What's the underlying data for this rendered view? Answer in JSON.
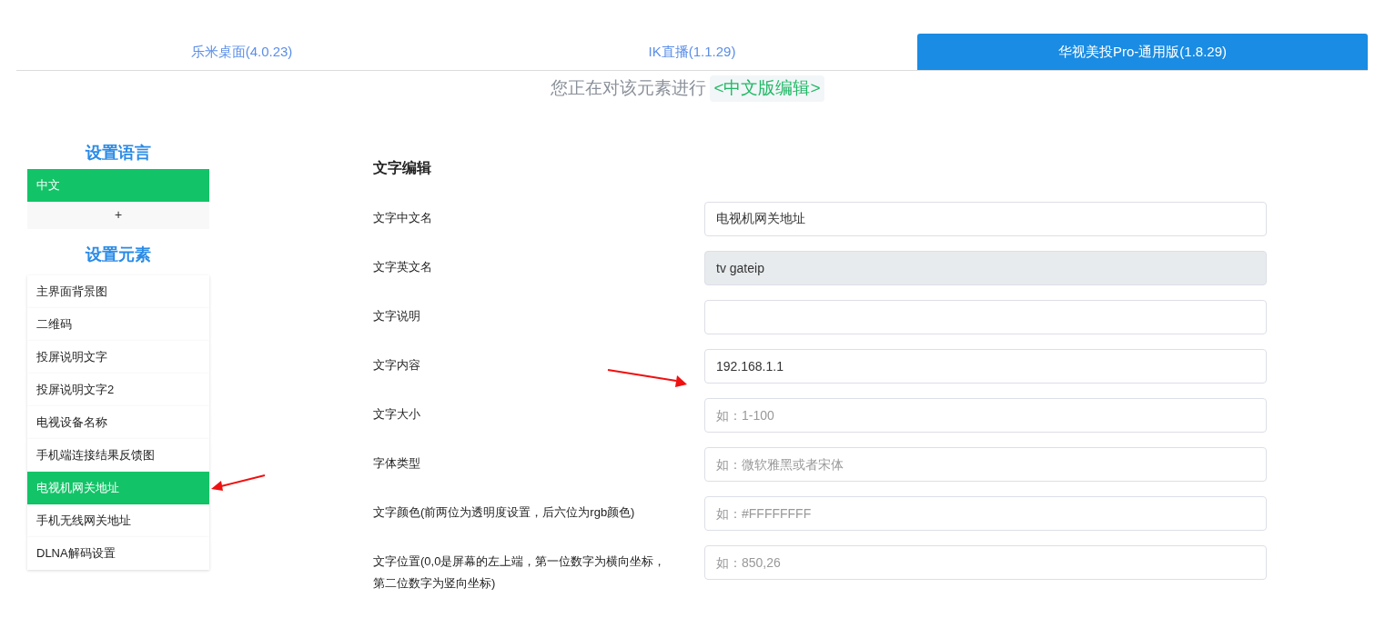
{
  "tabs": [
    {
      "label": "乐米桌面(4.0.23)",
      "selected": false
    },
    {
      "label": "IK直播(1.1.29)",
      "selected": false
    },
    {
      "label": "华视美投Pro-通用版(1.8.29)",
      "selected": true
    }
  ],
  "subtitle": {
    "text": "您正在对该元素进行",
    "tag": "<中文版编辑>"
  },
  "sidebar": {
    "language_title": "设置语言",
    "languages": [
      {
        "label": "中文",
        "selected": true
      }
    ],
    "add_button": "+",
    "elements_title": "设置元素",
    "elements": [
      {
        "label": "主界面背景图",
        "selected": false
      },
      {
        "label": "二维码",
        "selected": false
      },
      {
        "label": "投屏说明文字",
        "selected": false
      },
      {
        "label": "投屏说明文字2",
        "selected": false
      },
      {
        "label": "电视设备名称",
        "selected": false
      },
      {
        "label": "手机端连接结果反馈图",
        "selected": false
      },
      {
        "label": "电视机网关地址",
        "selected": true
      },
      {
        "label": "手机无线网关地址",
        "selected": false
      },
      {
        "label": "DLNA解码设置",
        "selected": false
      }
    ]
  },
  "form": {
    "title": "文字编辑",
    "fields": [
      {
        "label": "文字中文名",
        "value": "电视机网关地址",
        "disabled": false
      },
      {
        "label": "文字英文名",
        "value": "tv gateip",
        "disabled": true
      },
      {
        "label": "文字说明",
        "disabled": false
      },
      {
        "label": "文字内容",
        "value": "192.168.1.1",
        "disabled": false
      },
      {
        "label": "文字大小",
        "placeholder": "如：1-100",
        "disabled": false
      },
      {
        "label": "字体类型",
        "placeholder": "如：微软雅黑或者宋体",
        "disabled": false
      },
      {
        "label": "文字颜色(前两位为透明度设置，后六位为rgb颜色)",
        "placeholder": "如：#FFFFFFFF",
        "disabled": false
      },
      {
        "label": "文字位置(0,0是屏幕的左上端，第一位数字为横向坐标，第二位数字为竖向坐标)",
        "placeholder": "如：850,26",
        "disabled": false
      }
    ]
  }
}
